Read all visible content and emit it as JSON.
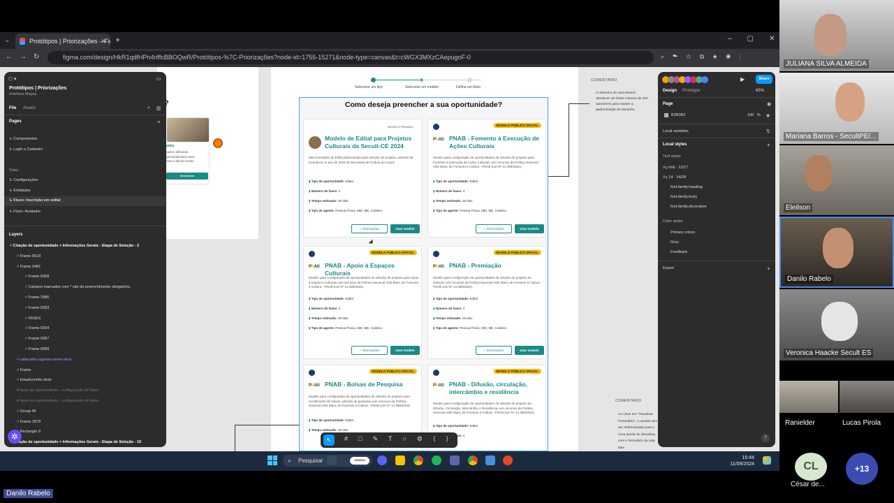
{
  "browser": {
    "tab_title": "Protótipos | Priorizações – Figm",
    "url": "figma.com/design/HkR1qdfHPn4riffcBBOQwR/Protótipos-%7C-Priorizações?node-id=1755-15271&node-type=canvas&t=cWGX3MXzCAepugoF-0",
    "new_tab": "+"
  },
  "left_panel": {
    "file_title": "Protótipos | Priorizações",
    "subtitle": "Interface Mapas",
    "tab_file": "File",
    "tab_assets": "Assets",
    "pages_heading": "Pages",
    "pages": [
      "Componentes",
      "Login e Cadastro"
    ],
    "telas_heading": "Telas",
    "telas": [
      "Configurações",
      "Entidades",
      "Fluxo: Inscrição em edital",
      "Fluxo: Avaliador"
    ],
    "layers_heading": "Layers",
    "layers": [
      "Criação de oportunidade > Informações Gerais - Etapa de Seleção - 2",
      "Frame 8518",
      "Frame 9481",
      "Frame 8368",
      "Campos marcados com * são de preenchimento obrigatório.",
      "Frame 2986",
      "Frame 8383",
      "FASES",
      "Frame 8394",
      "Frame 8387",
      "Frame 8389",
      "cabecalho-agentes-anne-eliza",
      "Frame",
      "breadcrumbs desk",
      "fases da oportunidade - configuração de fases",
      "fases da oportunidade - configuração de fases",
      "Group 45",
      "Frame 2878",
      "Rectangle 9",
      "Criação de oportunidade > Informações Gerais - Etapa de Seleção - 16"
    ]
  },
  "bg_frame": {
    "heading_fragment": "?",
    "card_title_fragment": "ados",
    "card_desc_fragment": "rados utilizando\n personalizados para\n reas culturais locais.",
    "card_button": "Selecionar"
  },
  "steps": [
    "Selecione um tipo",
    "Selecione um modelo",
    "Defina um título"
  ],
  "modal": {
    "title": "Como deseja preencher a sua oportunidade?",
    "info_label": "Informações",
    "use_label": "Usar modelo",
    "meta_labels": [
      "Tipo de oportunidade:",
      "Número de fases:",
      "Tempo estimado:",
      "Tipo de agente:"
    ],
    "cards": [
      {
        "badge": "MODELO PRIVADO",
        "title": "Modelo de Edital para Projetos Culturais da Secult-CE 2024",
        "desc": "Meu formulário de Edital padronizado para seleção de projetos culturais de incentivos no ano de 2024 da Secretaria de Cultura do Ceará.",
        "type": "Edital",
        "phases": "4",
        "time": "28 dias",
        "agent": "Pessoa Física, MEI, ME, Coletivo"
      },
      {
        "badge": "MODELO PÚBLICO OFICIAL",
        "title": "PNAB - Fomento à Execução de Ações Culturais",
        "desc": "Modelo para configuração de oportunidades de seleção de projetos para Fomento à Execução de Ações Culturais com recursos da Política Nacional Aldir Blanc de Fomento à Cultura - PNAB (LEI Nº 14.399/2022).",
        "type": "Edital",
        "phases": "4",
        "time": "28 dias",
        "agent": "Pessoa Física, MEI, ME, Coletivo"
      },
      {
        "badge": "MODELO PÚBLICO OFICIAL",
        "title": "PNAB - Apoio à Espaços Culturais",
        "desc": "Modelo para configuração de oportunidades de seleção de projetos para Apoio à Espaços Culturais com recursos da Política Nacional Aldir Blanc de Fomento à Cultura - PNAB (LEI Nº 14.399/2022).",
        "type": "Edital",
        "phases": "4",
        "time": "28 dias",
        "agent": "Pessoa Física, MEI, ME, Coletivo"
      },
      {
        "badge": "MODELO PÚBLICO OFICIAL",
        "title": "PNAB - Premiação",
        "desc": "Modelo para configuração de oportunidades de seleção de projetos de Seleção com recursos da Política Nacional Aldir Blanc de Fomento à Cultura - PNAB (LEI Nº 14.399/2022).",
        "type": "Edital",
        "phases": "4",
        "time": "28 dias",
        "agent": "Pessoa Física, MEI, ME, Coletivo"
      },
      {
        "badge": "MODELO PÚBLICO OFICIAL",
        "title": "PNAB - Bolsas de Pesquisa",
        "desc": "Modelo para configuração de oportunidades de seleção de projetos para recebimento de bolsas culturais de pesquisa com recursos da Política Nacional Aldir Blanc de Fomento à Cultura - PNAB (LEI Nº 14.399/2022).",
        "type": "Edital",
        "time": "28 dias"
      },
      {
        "badge": "MODELO PÚBLICO OFICIAL",
        "title": "PNAB - Difusão, circulação, intercâmbio e residência",
        "desc": "Modelo para configuração de oportunidades de seleção de projetos de Difusão, Circulação, Intercâmbio e Residência com recursos da Política Nacional Aldir Blanc de Fomento à Cultura - PNAB (LEI Nº 14.399/2022).",
        "type": "Edital",
        "phases": "4"
      }
    ]
  },
  "comments": [
    {
      "label": "COMENTÁRIO",
      "text": "O desenho do card deverá obedecer um limite máximo de 200 caracteres para manter a padronização de tamanho."
    },
    {
      "label": "COMENTÁRIO",
      "text": "Ao clicar em \"Visualizar Formulário\", o usuário dev ser redirecionado para u nova janela de visualizaç com o formulário da resp fase."
    }
  ],
  "right_panel": {
    "share": "Share",
    "tab_design": "Design",
    "tab_prototype": "Prototype",
    "zoom": "65%",
    "page_heading": "Page",
    "page_color": "B3B3B3",
    "page_opacity": "100",
    "page_pct": "%",
    "local_variables": "Local variables",
    "local_styles": "Local styles",
    "text_styles": "Text styles",
    "text_items": [
      "hh6 · 12/17",
      "14 · 14/28",
      "font.family.heading",
      "font.family.body",
      "font.family.decorative"
    ],
    "color_styles": "Color styles",
    "color_items": [
      "Primary colors",
      "Grey",
      "Feedback"
    ],
    "export": "Export",
    "help": "?"
  },
  "taskbar": {
    "search": "Pesquisar",
    "time": "15:44",
    "date": "11/09/2024",
    "genesis": "GENESIS"
  },
  "participants": [
    {
      "name": "JULIANA SILVA ALMEIDA"
    },
    {
      "name": "Mariana Barros - SecultPE/..."
    },
    {
      "name": "Eleilson"
    },
    {
      "name": "Danilo Rabelo"
    },
    {
      "name": "Veronica Haacke Secult ES"
    },
    {
      "name": "Ranielder"
    },
    {
      "name": "Lucas Pirola"
    }
  ],
  "extra": {
    "initials": "CL",
    "name": "César de...",
    "more": "+13"
  },
  "presenter": "Danilo Rabelo",
  "colors": {
    "teal": "#1a8a86",
    "badge": "#f5b800",
    "figma_panel": "#2c2c2c",
    "share_blue": "#0d99ff"
  }
}
